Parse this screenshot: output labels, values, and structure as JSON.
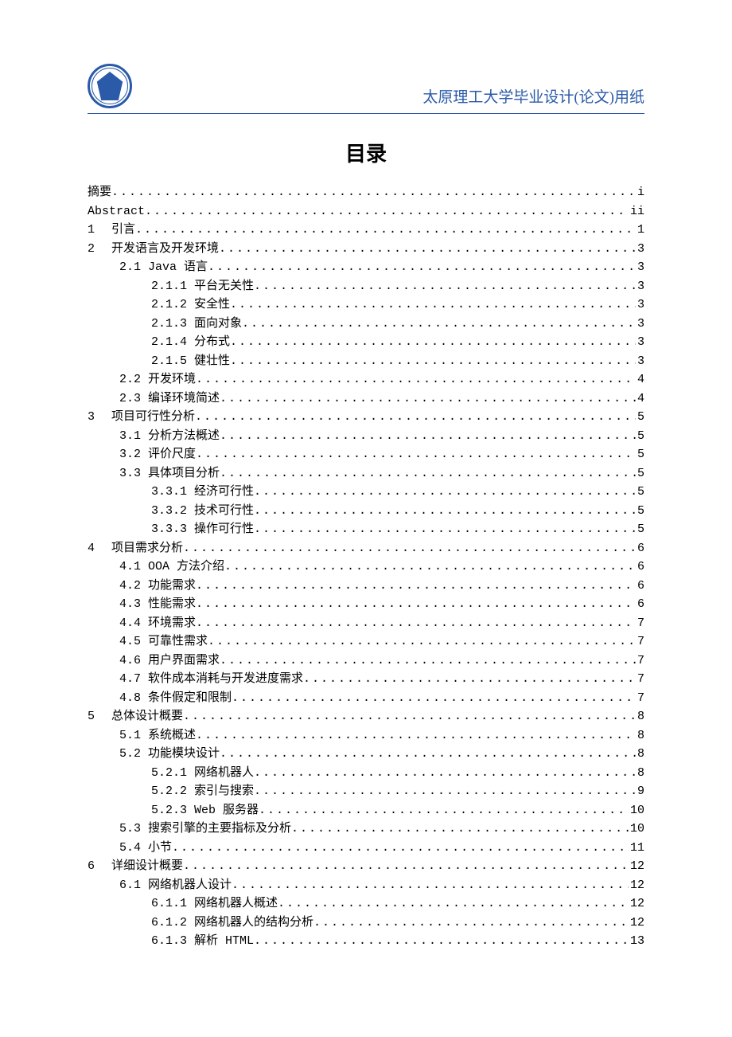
{
  "header": {
    "title": "太原理工大学毕业设计(论文)用纸"
  },
  "toc_title": "目录",
  "entries": [
    {
      "indent": 0,
      "num": "",
      "label": "摘要",
      "page": "i"
    },
    {
      "indent": 0,
      "num": "",
      "label": "Abstract",
      "page": "ii"
    },
    {
      "indent": 0,
      "num": "1",
      "label": "引言",
      "page": "1"
    },
    {
      "indent": 0,
      "num": "2",
      "label": "开发语言及开发环境",
      "page": "3"
    },
    {
      "indent": 1,
      "num": "",
      "label": "2.1 Java 语言 ",
      "page": "3"
    },
    {
      "indent": 2,
      "num": "",
      "label": "2.1.1 平台无关性",
      "page": "3"
    },
    {
      "indent": 2,
      "num": "",
      "label": "2.1.2 安全性",
      "page": "3"
    },
    {
      "indent": 2,
      "num": "",
      "label": "2.1.3 面向对象",
      "page": "3"
    },
    {
      "indent": 2,
      "num": "",
      "label": "2.1.4 分布式",
      "page": "3"
    },
    {
      "indent": 2,
      "num": "",
      "label": "2.1.5 健壮性",
      "page": "3"
    },
    {
      "indent": 1,
      "num": "",
      "label": "2.2 开发环境",
      "page": "4"
    },
    {
      "indent": 1,
      "num": "",
      "label": "2.3 编译环境简述",
      "page": "4"
    },
    {
      "indent": 0,
      "num": "3",
      "label": "项目可行性分析",
      "page": "5"
    },
    {
      "indent": 1,
      "num": "",
      "label": "3.1 分析方法概述",
      "page": "5"
    },
    {
      "indent": 1,
      "num": "",
      "label": "3.2 评价尺度",
      "page": "5"
    },
    {
      "indent": 1,
      "num": "",
      "label": "3.3 具体项目分析",
      "page": "5"
    },
    {
      "indent": 2,
      "num": "",
      "label": "3.3.1 经济可行性",
      "page": "5"
    },
    {
      "indent": 2,
      "num": "",
      "label": "3.3.2 技术可行性",
      "page": "5"
    },
    {
      "indent": 2,
      "num": "",
      "label": "3.3.3 操作可行性",
      "page": "5"
    },
    {
      "indent": 0,
      "num": "4",
      "label": "项目需求分析",
      "page": "6"
    },
    {
      "indent": 1,
      "num": "",
      "label": "4.1 OOA 方法介绍 ",
      "page": "6"
    },
    {
      "indent": 1,
      "num": "",
      "label": "4.2 功能需求",
      "page": "6"
    },
    {
      "indent": 1,
      "num": "",
      "label": "4.3 性能需求",
      "page": "6"
    },
    {
      "indent": 1,
      "num": "",
      "label": "4.4 环境需求",
      "page": "7"
    },
    {
      "indent": 1,
      "num": "",
      "label": "4.5 可靠性需求",
      "page": "7"
    },
    {
      "indent": 1,
      "num": "",
      "label": "4.6 用户界面需求",
      "page": "7"
    },
    {
      "indent": 1,
      "num": "",
      "label": "4.7 软件成本消耗与开发进度需求",
      "page": "7"
    },
    {
      "indent": 1,
      "num": "",
      "label": "4.8 条件假定和限制",
      "page": "7"
    },
    {
      "indent": 0,
      "num": "5",
      "label": "总体设计概要",
      "page": "8"
    },
    {
      "indent": 1,
      "num": "",
      "label": "5.1 系统概述",
      "page": "8"
    },
    {
      "indent": 1,
      "num": "",
      "label": "5.2 功能模块设计",
      "page": "8"
    },
    {
      "indent": 2,
      "num": "",
      "label": "5.2.1 网络机器人",
      "page": "8"
    },
    {
      "indent": 2,
      "num": "",
      "label": "5.2.2 索引与搜索",
      "page": "9"
    },
    {
      "indent": 2,
      "num": "",
      "label": "5.2.3 Web 服务器 ",
      "page": "10"
    },
    {
      "indent": 1,
      "num": "",
      "label": "5.3 搜索引擎的主要指标及分析",
      "page": "10"
    },
    {
      "indent": 1,
      "num": "",
      "label": "5.4 小节",
      "page": "11"
    },
    {
      "indent": 0,
      "num": "6",
      "label": "详细设计概要",
      "page": "12"
    },
    {
      "indent": 1,
      "num": "",
      "label": "6.1 网络机器人设计",
      "page": "12"
    },
    {
      "indent": 2,
      "num": "",
      "label": "6.1.1 网络机器人概述",
      "page": "12"
    },
    {
      "indent": 2,
      "num": "",
      "label": "6.1.2 网络机器人的结构分析",
      "page": "12"
    },
    {
      "indent": 2,
      "num": "",
      "label": "6.1.3 解析 HTML ",
      "page": "13"
    }
  ]
}
